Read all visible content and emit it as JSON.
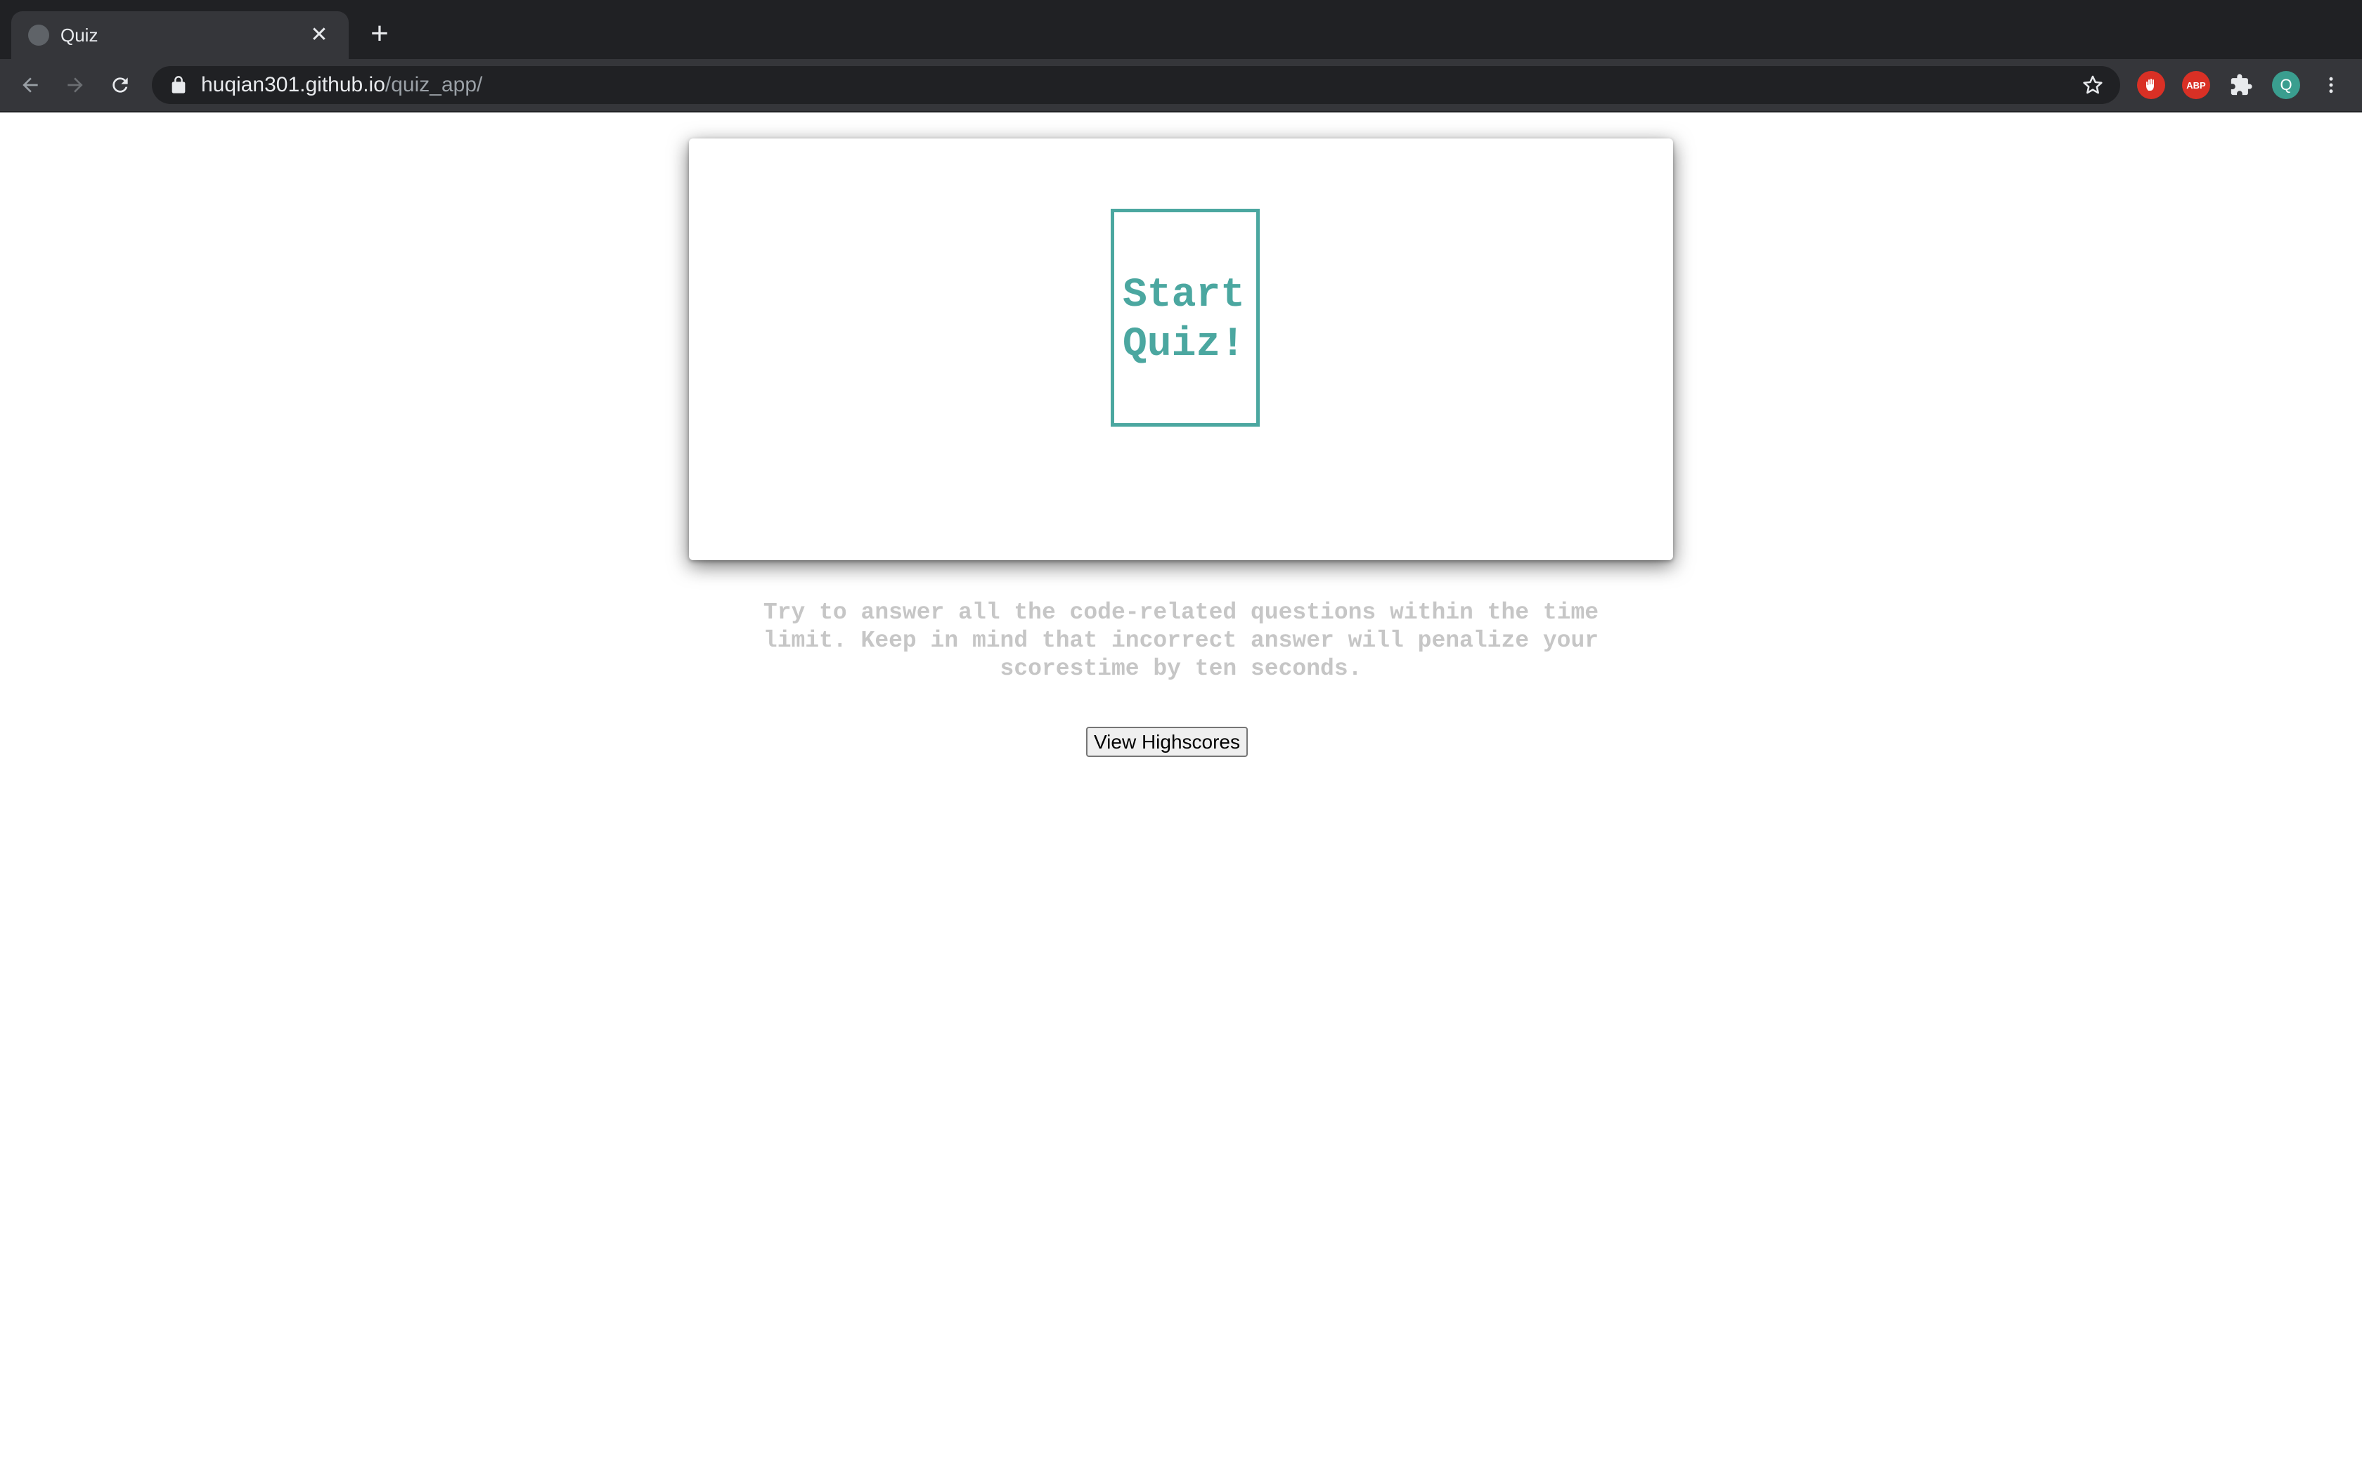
{
  "browser": {
    "tab": {
      "title": "Quiz",
      "close_label": "✕"
    },
    "new_tab_label": "+",
    "address_bar": {
      "host": "huqian301.github.io",
      "path": "/quiz_app/"
    },
    "extensions": {
      "abp_label": "ABP",
      "avatar_initial": "Q"
    }
  },
  "page": {
    "start_button_label": "Start Quiz!",
    "instructions": "Try to answer all the code-related questions within the time limit. Keep in mind that incorrect answer will penalize your scorestime by ten seconds.",
    "highscores_button_label": "View Highscores"
  },
  "colors": {
    "accent": "#4ba7a0",
    "instructions_text": "#c6c6c6",
    "chrome_dark": "#202124",
    "chrome_toolbar": "#35363a"
  }
}
